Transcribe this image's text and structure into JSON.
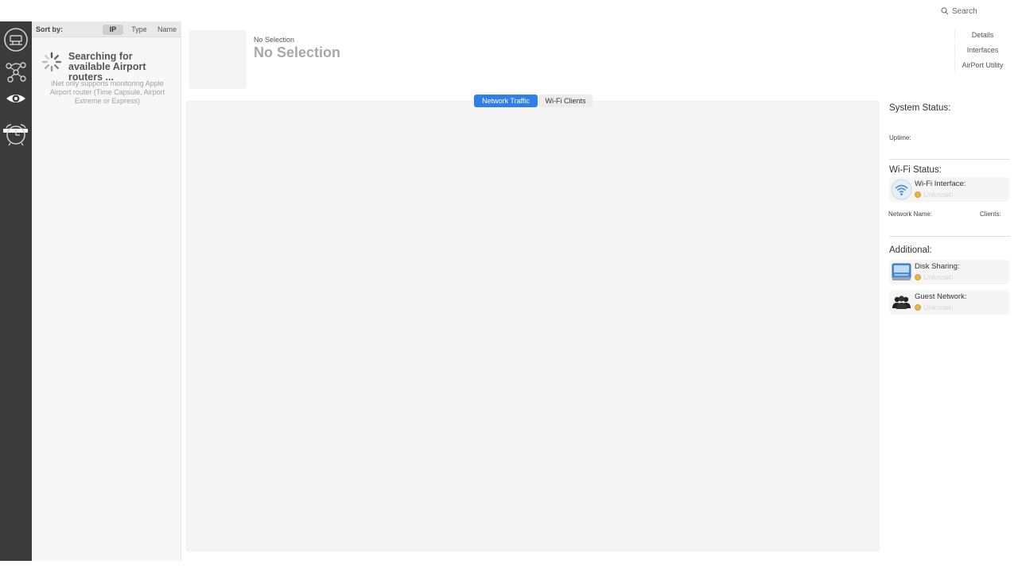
{
  "toolbar": {
    "search_label": "Search"
  },
  "rail": {
    "items": [
      "network-icon",
      "topology-icon",
      "eye-icon",
      "alarm-clock-icon"
    ],
    "active": "eye-icon"
  },
  "sidebar": {
    "sort_label": "Sort by:",
    "sort_options": [
      "IP",
      "Type",
      "Name"
    ],
    "sort_active": "IP",
    "searching_text": "Searching for available Airport routers ...",
    "note": "iNet only supports monitoring Apple Airport router (Time Capsule, Airport Extreme or Express)"
  },
  "header": {
    "selection_small": "No Selection",
    "selection_big": "No Selection"
  },
  "right_links": [
    "Details",
    "Interfaces",
    "AirPort Utility"
  ],
  "tabs": {
    "active": "Network Traffic",
    "inactive": "Wi-Fi Clients"
  },
  "system_status": {
    "title": "System Status:",
    "uptime_label": "Uptime:"
  },
  "wifi_status": {
    "title": "Wi-Fi Status:",
    "interface_label": "Wi-Fi Interface:",
    "interface_value": "Unknown",
    "network_name_label": "Network Name:",
    "clients_label": "Clients:"
  },
  "additional": {
    "title": "Additional:",
    "disk_sharing_label": "Disk Sharing:",
    "disk_sharing_value": "Unknown",
    "guest_network_label": "Guest Network:",
    "guest_network_value": "Unknown"
  },
  "colors": {
    "accent": "#2f7fe6",
    "rail": "#3b3b3b",
    "status_dot": "#e5b64a"
  }
}
